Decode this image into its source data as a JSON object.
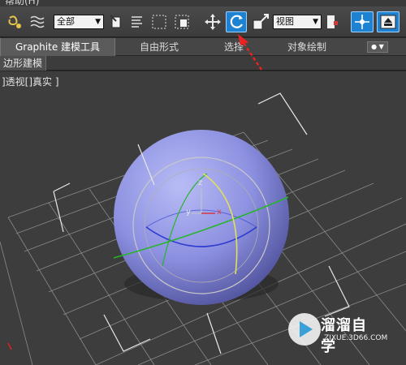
{
  "menu": {
    "help_label": "帮助(H)"
  },
  "toolbar": {
    "selection_filter": "全部",
    "ref_coord_system": "视图",
    "icons": [
      "select-link-icon",
      "bind-spacewarp-icon",
      "select-object-icon",
      "select-by-name-icon",
      "rect-selection-icon",
      "window-crossing-icon",
      "move-icon",
      "rotate-icon",
      "scale-icon",
      "pivot-icon",
      "selection-lock-icon",
      "align-icon"
    ]
  },
  "ribbon": {
    "tabs": [
      {
        "label": "Graphite 建模工具",
        "active": true
      },
      {
        "label": "自由形式",
        "active": false
      },
      {
        "label": "选择",
        "active": false
      },
      {
        "label": "对象绘制",
        "active": false
      }
    ]
  },
  "subpanel": {
    "label": "边形建模"
  },
  "viewport": {
    "label": "]透视[]真实 ]",
    "object": "sphere",
    "gizmo": "rotate",
    "axis_labels": {
      "x": "x",
      "y": "y",
      "z": "z"
    },
    "colors": {
      "sphere": "#8c90e0",
      "grid": "#8a8a8a",
      "background": "#3d3d3d",
      "accent": "#1e82d2"
    }
  },
  "watermark": {
    "title": "溜溜自学",
    "url": "ZIXUE.3D66.COM"
  }
}
